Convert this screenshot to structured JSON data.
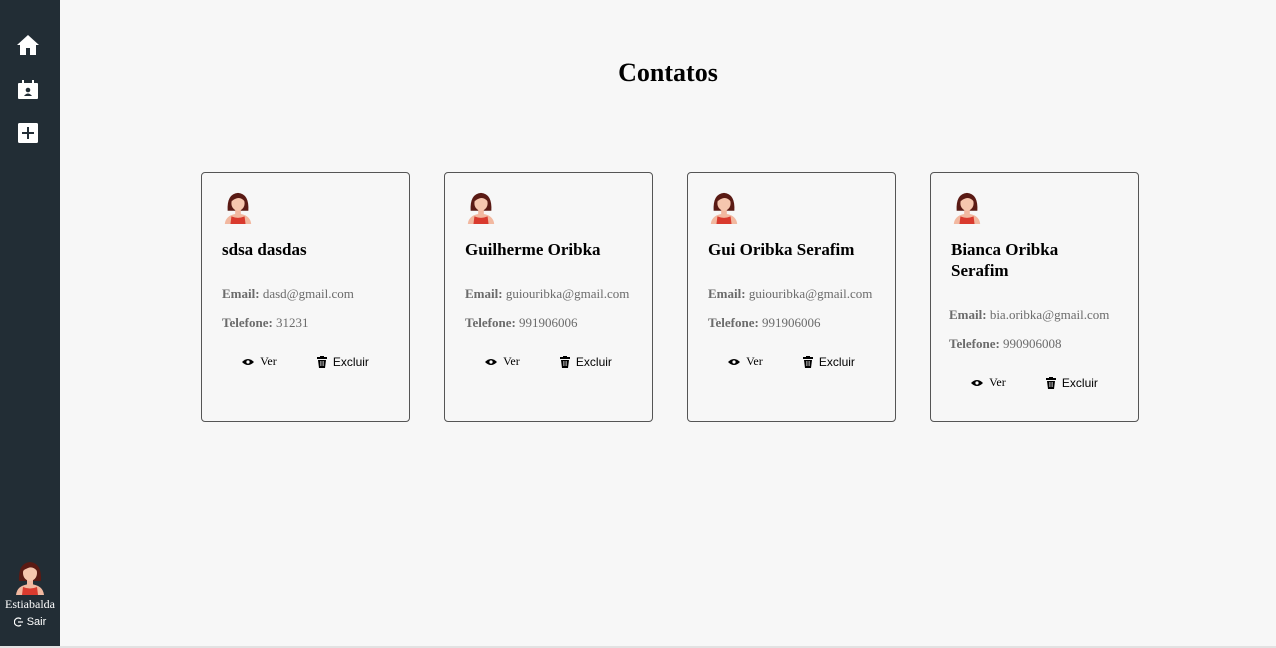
{
  "nav": {
    "items": [
      {
        "name": "home",
        "icon": "home-icon"
      },
      {
        "name": "contacts",
        "icon": "contact-calendar-icon"
      },
      {
        "name": "add",
        "icon": "plus-square-icon"
      }
    ]
  },
  "user": {
    "name": "Estiabalda",
    "logout_label": "Sair",
    "avatar_icon": "woman-avatar-icon",
    "logout_icon": "logout-icon"
  },
  "page": {
    "title": "Contatos"
  },
  "labels": {
    "email": "Email:",
    "phone": "Telefone:",
    "view": "Ver",
    "delete": "Excluir"
  },
  "contacts": [
    {
      "name": "sdsa dasdas",
      "email": "dasd@gmail.com",
      "phone": "31231"
    },
    {
      "name": "Guilherme Oribka",
      "email": "guiouribka@gmail.com",
      "phone": "991906006"
    },
    {
      "name": "Gui Oribka Serafim",
      "email": "guiouribka@gmail.com",
      "phone": "991906006"
    },
    {
      "name": "Bianca Oribka Serafim",
      "email": "bia.oribka@gmail.com",
      "phone": "990906008"
    }
  ],
  "colors": {
    "sidebar": "#222d35",
    "background": "#f7f7f7",
    "field_text": "#6b6b6b"
  }
}
